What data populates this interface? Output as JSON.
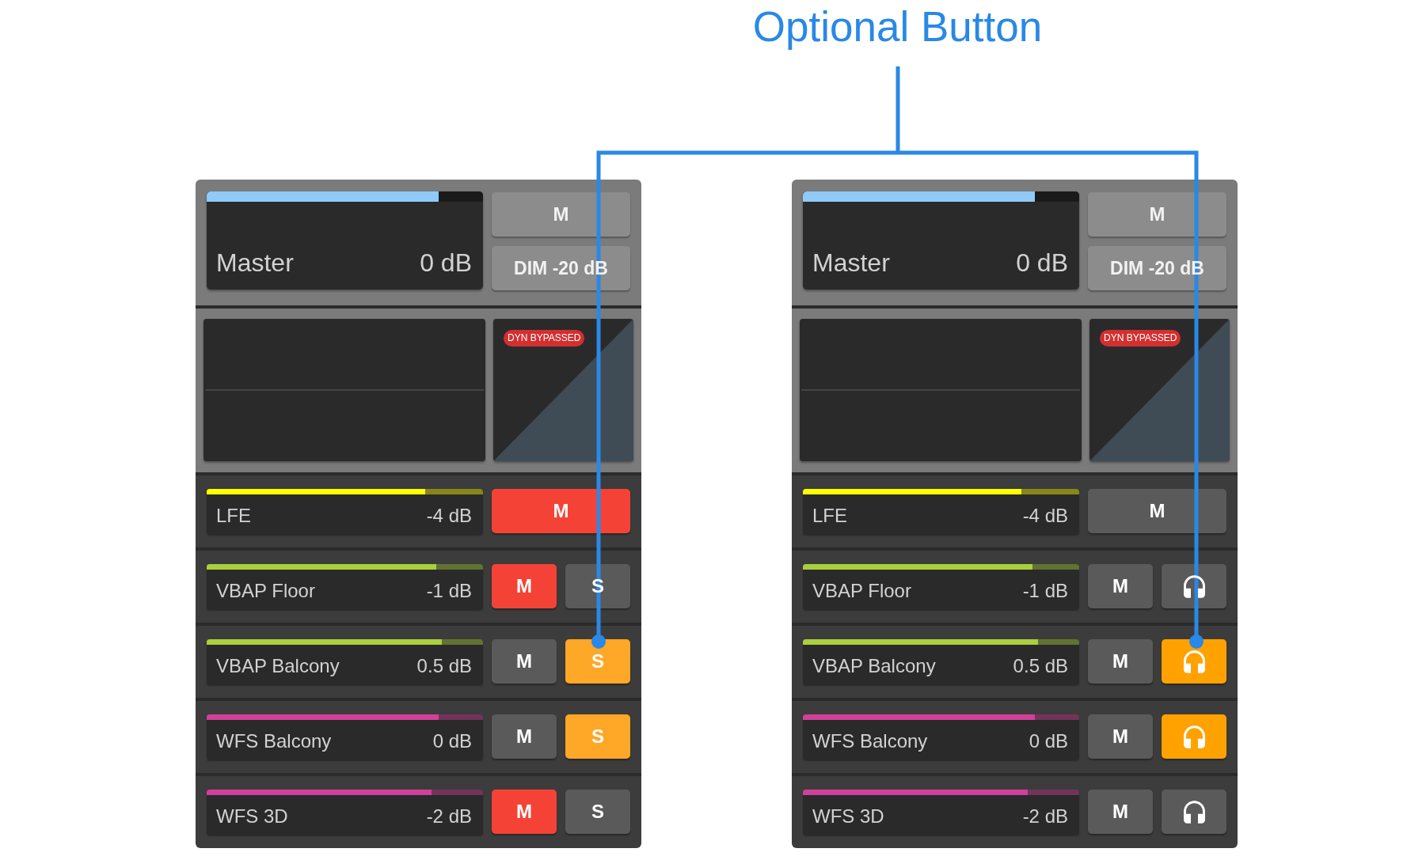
{
  "callout": {
    "label": "Optional Button"
  },
  "panels": [
    {
      "master": {
        "name": "Master",
        "reading": "0 dB",
        "level": 0.84,
        "mute": {
          "label": "M",
          "on": false
        },
        "dim": {
          "label": "DIM -20 dB",
          "on": false
        }
      },
      "dynamics": {
        "badge": "DYN BYPASSED"
      },
      "channels": [
        {
          "name": "LFE",
          "reading": "-4 dB",
          "level": 0.79,
          "color": "#ffff00",
          "buttons": [
            {
              "kind": "mute",
              "label": "M",
              "on": true
            }
          ]
        },
        {
          "name": "VBAP Floor",
          "reading": "-1 dB",
          "level": 0.83,
          "color": "#aad03c",
          "buttons": [
            {
              "kind": "mute",
              "label": "M",
              "on": true
            },
            {
              "kind": "solo",
              "label": "S",
              "on": false
            }
          ]
        },
        {
          "name": "VBAP Balcony",
          "reading": "0.5 dB",
          "level": 0.85,
          "color": "#aad03c",
          "buttons": [
            {
              "kind": "mute",
              "label": "M",
              "on": false
            },
            {
              "kind": "solo",
              "label": "S",
              "on": true
            }
          ]
        },
        {
          "name": "WFS Balcony",
          "reading": "0 dB",
          "level": 0.84,
          "color": "#d1409a",
          "buttons": [
            {
              "kind": "mute",
              "label": "M",
              "on": false
            },
            {
              "kind": "solo",
              "label": "S",
              "on": true
            }
          ]
        },
        {
          "name": "WFS 3D",
          "reading": "-2 dB",
          "level": 0.815,
          "color": "#d1409a",
          "buttons": [
            {
              "kind": "mute",
              "label": "M",
              "on": true
            },
            {
              "kind": "solo",
              "label": "S",
              "on": false
            }
          ]
        }
      ]
    },
    {
      "master": {
        "name": "Master",
        "reading": "0 dB",
        "level": 0.84,
        "mute": {
          "label": "M",
          "on": false
        },
        "dim": {
          "label": "DIM -20 dB",
          "on": false
        }
      },
      "dynamics": {
        "badge": "DYN BYPASSED"
      },
      "channels": [
        {
          "name": "LFE",
          "reading": "-4 dB",
          "level": 0.79,
          "color": "#ffff00",
          "buttons": [
            {
              "kind": "mute",
              "label": "M",
              "on": false
            }
          ]
        },
        {
          "name": "VBAP Floor",
          "reading": "-1 dB",
          "level": 0.83,
          "color": "#aad03c",
          "buttons": [
            {
              "kind": "mute",
              "label": "M",
              "on": false
            },
            {
              "kind": "listen",
              "on": false
            }
          ]
        },
        {
          "name": "VBAP Balcony",
          "reading": "0.5 dB",
          "level": 0.85,
          "color": "#aad03c",
          "buttons": [
            {
              "kind": "mute",
              "label": "M",
              "on": false
            },
            {
              "kind": "listen",
              "on": true
            }
          ]
        },
        {
          "name": "WFS Balcony",
          "reading": "0 dB",
          "level": 0.84,
          "color": "#d1409a",
          "buttons": [
            {
              "kind": "mute",
              "label": "M",
              "on": false
            },
            {
              "kind": "listen",
              "on": true
            }
          ]
        },
        {
          "name": "WFS 3D",
          "reading": "-2 dB",
          "level": 0.815,
          "color": "#d1409a",
          "buttons": [
            {
              "kind": "mute",
              "label": "M",
              "on": false
            },
            {
              "kind": "listen",
              "on": false
            }
          ]
        }
      ]
    }
  ]
}
